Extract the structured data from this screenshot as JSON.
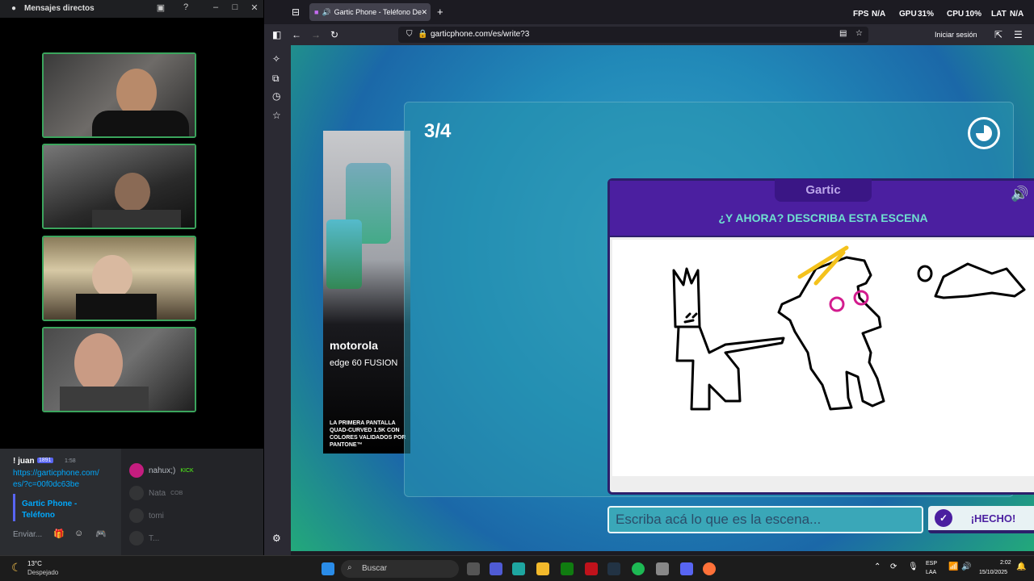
{
  "discord": {
    "title": "Mensajes directos",
    "chat": {
      "user": "! juan",
      "badge": "1891",
      "time": "1:58",
      "link": "https://garticphone.com/es/?c=00f0dc63be",
      "embed_title": "Gartic Phone - Teléfono",
      "input_placeholder": "Enviar..."
    },
    "members": [
      {
        "name": "nahux;)",
        "tag": "KICK"
      },
      {
        "name": "Nata",
        "tag": "COB"
      },
      {
        "name": "tomi",
        "tag": ""
      },
      {
        "name": "T...",
        "tag": ""
      }
    ]
  },
  "browser": {
    "tab_title": "Gartic Phone - Teléfono De",
    "url": "garticphone.com/es/write?3",
    "signin": "Iniciar sesión",
    "stats": {
      "fps_label": "FPS",
      "fps": "N/A",
      "gpu_label": "GPU",
      "gpu": "31%",
      "cpu_label": "CPU",
      "cpu": "10%",
      "lat_label": "LAT",
      "lat": "N/A"
    }
  },
  "game": {
    "round": "3/4",
    "logo": "Gartic",
    "heading": "¿Y AHORA? DESCRIBA ESTA ESCENA",
    "input_placeholder": "Escriba acá lo que es la escena...",
    "done_label": "¡HECHO!"
  },
  "ad": {
    "brand": "motorola",
    "model": "edge 60 FUSION",
    "tagline": "LA PRIMERA PANTALLA QUAD-CURVED 1.5K CON COLORES VALIDADOS POR PANTONE™"
  },
  "taskbar": {
    "search": "Buscar",
    "weather_temp": "13°C",
    "weather_desc": "Despejado",
    "lang": "ESP",
    "lang2": "LAA",
    "time": "2:02",
    "date": "15/10/2025"
  }
}
